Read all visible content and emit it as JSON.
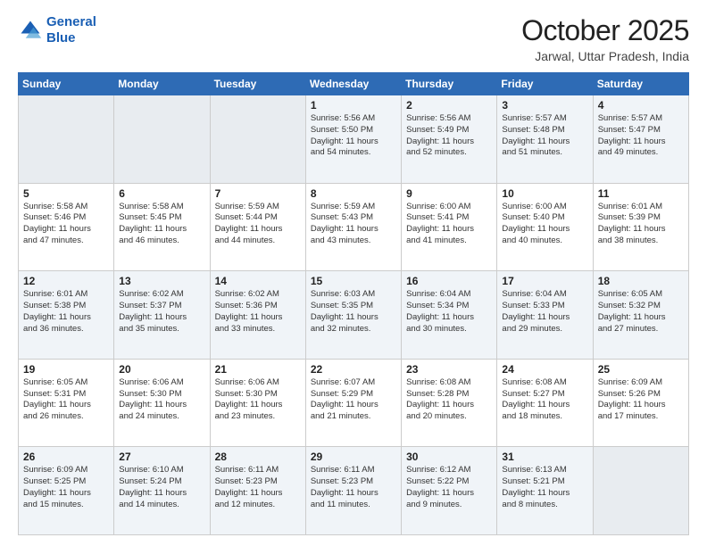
{
  "header": {
    "logo_line1": "General",
    "logo_line2": "Blue",
    "month": "October 2025",
    "location": "Jarwal, Uttar Pradesh, India"
  },
  "weekdays": [
    "Sunday",
    "Monday",
    "Tuesday",
    "Wednesday",
    "Thursday",
    "Friday",
    "Saturday"
  ],
  "weeks": [
    [
      {
        "day": "",
        "info": ""
      },
      {
        "day": "",
        "info": ""
      },
      {
        "day": "",
        "info": ""
      },
      {
        "day": "1",
        "info": "Sunrise: 5:56 AM\nSunset: 5:50 PM\nDaylight: 11 hours\nand 54 minutes."
      },
      {
        "day": "2",
        "info": "Sunrise: 5:56 AM\nSunset: 5:49 PM\nDaylight: 11 hours\nand 52 minutes."
      },
      {
        "day": "3",
        "info": "Sunrise: 5:57 AM\nSunset: 5:48 PM\nDaylight: 11 hours\nand 51 minutes."
      },
      {
        "day": "4",
        "info": "Sunrise: 5:57 AM\nSunset: 5:47 PM\nDaylight: 11 hours\nand 49 minutes."
      }
    ],
    [
      {
        "day": "5",
        "info": "Sunrise: 5:58 AM\nSunset: 5:46 PM\nDaylight: 11 hours\nand 47 minutes."
      },
      {
        "day": "6",
        "info": "Sunrise: 5:58 AM\nSunset: 5:45 PM\nDaylight: 11 hours\nand 46 minutes."
      },
      {
        "day": "7",
        "info": "Sunrise: 5:59 AM\nSunset: 5:44 PM\nDaylight: 11 hours\nand 44 minutes."
      },
      {
        "day": "8",
        "info": "Sunrise: 5:59 AM\nSunset: 5:43 PM\nDaylight: 11 hours\nand 43 minutes."
      },
      {
        "day": "9",
        "info": "Sunrise: 6:00 AM\nSunset: 5:41 PM\nDaylight: 11 hours\nand 41 minutes."
      },
      {
        "day": "10",
        "info": "Sunrise: 6:00 AM\nSunset: 5:40 PM\nDaylight: 11 hours\nand 40 minutes."
      },
      {
        "day": "11",
        "info": "Sunrise: 6:01 AM\nSunset: 5:39 PM\nDaylight: 11 hours\nand 38 minutes."
      }
    ],
    [
      {
        "day": "12",
        "info": "Sunrise: 6:01 AM\nSunset: 5:38 PM\nDaylight: 11 hours\nand 36 minutes."
      },
      {
        "day": "13",
        "info": "Sunrise: 6:02 AM\nSunset: 5:37 PM\nDaylight: 11 hours\nand 35 minutes."
      },
      {
        "day": "14",
        "info": "Sunrise: 6:02 AM\nSunset: 5:36 PM\nDaylight: 11 hours\nand 33 minutes."
      },
      {
        "day": "15",
        "info": "Sunrise: 6:03 AM\nSunset: 5:35 PM\nDaylight: 11 hours\nand 32 minutes."
      },
      {
        "day": "16",
        "info": "Sunrise: 6:04 AM\nSunset: 5:34 PM\nDaylight: 11 hours\nand 30 minutes."
      },
      {
        "day": "17",
        "info": "Sunrise: 6:04 AM\nSunset: 5:33 PM\nDaylight: 11 hours\nand 29 minutes."
      },
      {
        "day": "18",
        "info": "Sunrise: 6:05 AM\nSunset: 5:32 PM\nDaylight: 11 hours\nand 27 minutes."
      }
    ],
    [
      {
        "day": "19",
        "info": "Sunrise: 6:05 AM\nSunset: 5:31 PM\nDaylight: 11 hours\nand 26 minutes."
      },
      {
        "day": "20",
        "info": "Sunrise: 6:06 AM\nSunset: 5:30 PM\nDaylight: 11 hours\nand 24 minutes."
      },
      {
        "day": "21",
        "info": "Sunrise: 6:06 AM\nSunset: 5:30 PM\nDaylight: 11 hours\nand 23 minutes."
      },
      {
        "day": "22",
        "info": "Sunrise: 6:07 AM\nSunset: 5:29 PM\nDaylight: 11 hours\nand 21 minutes."
      },
      {
        "day": "23",
        "info": "Sunrise: 6:08 AM\nSunset: 5:28 PM\nDaylight: 11 hours\nand 20 minutes."
      },
      {
        "day": "24",
        "info": "Sunrise: 6:08 AM\nSunset: 5:27 PM\nDaylight: 11 hours\nand 18 minutes."
      },
      {
        "day": "25",
        "info": "Sunrise: 6:09 AM\nSunset: 5:26 PM\nDaylight: 11 hours\nand 17 minutes."
      }
    ],
    [
      {
        "day": "26",
        "info": "Sunrise: 6:09 AM\nSunset: 5:25 PM\nDaylight: 11 hours\nand 15 minutes."
      },
      {
        "day": "27",
        "info": "Sunrise: 6:10 AM\nSunset: 5:24 PM\nDaylight: 11 hours\nand 14 minutes."
      },
      {
        "day": "28",
        "info": "Sunrise: 6:11 AM\nSunset: 5:23 PM\nDaylight: 11 hours\nand 12 minutes."
      },
      {
        "day": "29",
        "info": "Sunrise: 6:11 AM\nSunset: 5:23 PM\nDaylight: 11 hours\nand 11 minutes."
      },
      {
        "day": "30",
        "info": "Sunrise: 6:12 AM\nSunset: 5:22 PM\nDaylight: 11 hours\nand 9 minutes."
      },
      {
        "day": "31",
        "info": "Sunrise: 6:13 AM\nSunset: 5:21 PM\nDaylight: 11 hours\nand 8 minutes."
      },
      {
        "day": "",
        "info": ""
      }
    ]
  ]
}
